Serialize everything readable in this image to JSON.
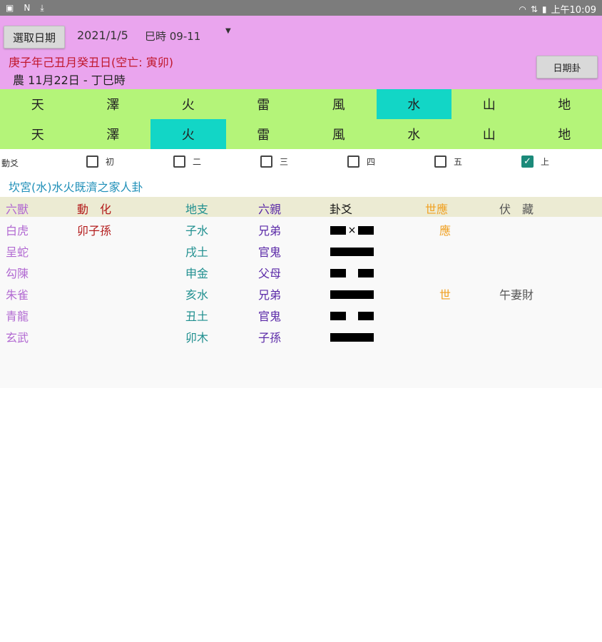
{
  "status_bar": {
    "left_icons": [
      "image-icon",
      "n-icon",
      "download-icon"
    ],
    "time": "上午10:09"
  },
  "header": {
    "select_date_label": "選取日期",
    "date": "2021/1/5",
    "time_slot": "巳時 09-11",
    "ganzhi": "庚子年己丑月癸丑日(空亡: 寅卯)",
    "lunar": "農 11月22日 - 丁巳時",
    "date_gua_label": "日期卦"
  },
  "trigrams": {
    "upper": [
      "天",
      "澤",
      "火",
      "雷",
      "風",
      "水",
      "山",
      "地"
    ],
    "lower": [
      "天",
      "澤",
      "火",
      "雷",
      "風",
      "水",
      "山",
      "地"
    ],
    "upper_selected": "水",
    "lower_selected": "火",
    "selected_color": "#12d6c6"
  },
  "moving_lines": {
    "label": "動爻",
    "options": [
      {
        "label": "初",
        "checked": false
      },
      {
        "label": "二",
        "checked": false
      },
      {
        "label": "三",
        "checked": false
      },
      {
        "label": "四",
        "checked": false
      },
      {
        "label": "五",
        "checked": false
      },
      {
        "label": "上",
        "checked": true
      }
    ]
  },
  "hexagram_title": "坎宮(水)水火既濟之家人卦",
  "table": {
    "headers": {
      "beast": "六獸",
      "move": "動　化",
      "branch": "地支",
      "relation": "六親",
      "line": "卦爻",
      "shi_ying": "世應",
      "fu": "伏　藏"
    },
    "rows": [
      {
        "beast": "白虎",
        "move": "卯子孫",
        "branch": "子水",
        "relation": "兄弟",
        "line": "moving-yin",
        "shi_ying": "應",
        "fu": ""
      },
      {
        "beast": "呈蛇",
        "move": "",
        "branch": "戌土",
        "relation": "官鬼",
        "line": "yang",
        "shi_ying": "",
        "fu": ""
      },
      {
        "beast": "勾陳",
        "move": "",
        "branch": "申金",
        "relation": "父母",
        "line": "yin",
        "shi_ying": "",
        "fu": ""
      },
      {
        "beast": "朱雀",
        "move": "",
        "branch": "亥水",
        "relation": "兄弟",
        "line": "yang",
        "shi_ying": "世",
        "fu": "午妻財"
      },
      {
        "beast": "青龍",
        "move": "",
        "branch": "丑土",
        "relation": "官鬼",
        "line": "yin",
        "shi_ying": "",
        "fu": ""
      },
      {
        "beast": "玄武",
        "move": "",
        "branch": "卯木",
        "relation": "子孫",
        "line": "yang",
        "shi_ying": "",
        "fu": ""
      }
    ],
    "moving_mark": "×"
  }
}
